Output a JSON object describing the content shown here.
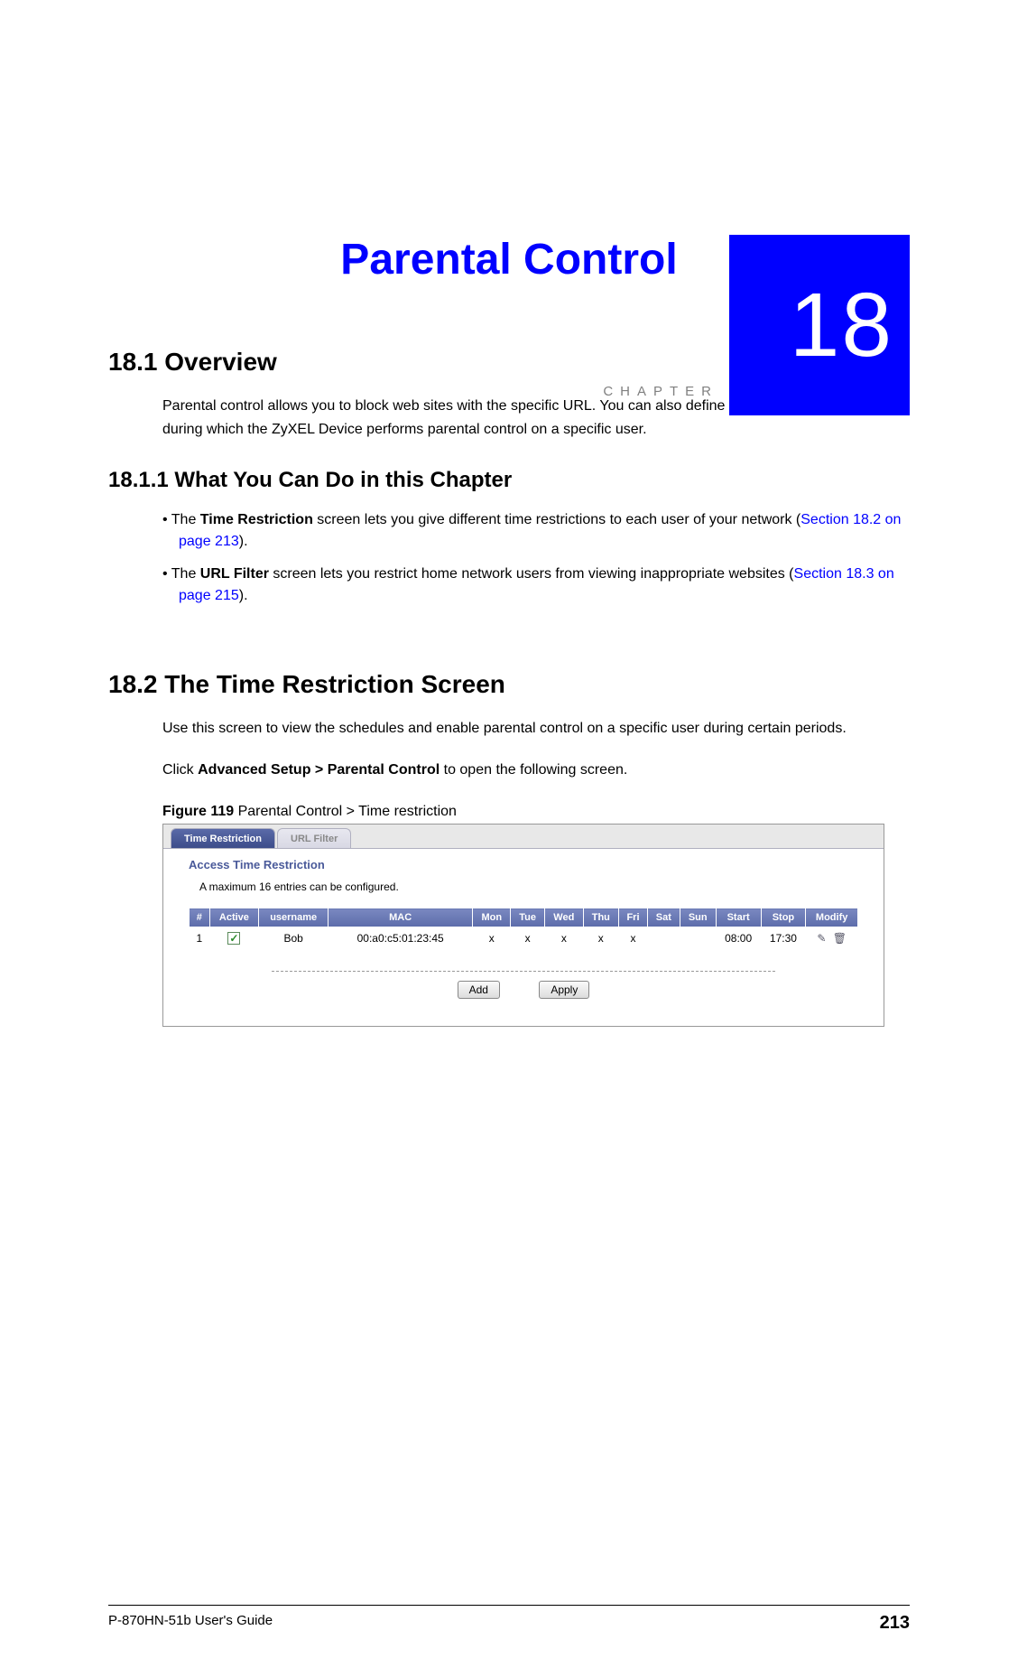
{
  "chapter": {
    "label": "CHAPTER",
    "number": "18",
    "title": "Parental Control"
  },
  "section_18_1": {
    "heading": "18.1  Overview",
    "body": "Parental control allows you to block web sites with the specific URL. You can also define time periods and days during which the ZyXEL Device performs parental control on a specific user."
  },
  "section_18_1_1": {
    "heading": "18.1.1  What You Can Do in this Chapter",
    "bullet1_a": "The ",
    "bullet1_bold": "Time Restriction",
    "bullet1_b": " screen lets you give different time restrictions to each user of your network (",
    "bullet1_link": "Section 18.2 on page 213",
    "bullet1_c": ").",
    "bullet2_a": "The ",
    "bullet2_bold": "URL Filter",
    "bullet2_b": " screen lets you restrict home network users from viewing inappropriate websites (",
    "bullet2_link": "Section 18.3 on page 215",
    "bullet2_c": ")."
  },
  "section_18_2": {
    "heading": "18.2  The Time Restriction Screen",
    "body1": "Use this screen to view the schedules and enable parental control on a specific user during certain periods.",
    "body2_a": "Click ",
    "body2_bold": "Advanced Setup > Parental Control",
    "body2_b": " to open the following screen."
  },
  "figure": {
    "label": "Figure 119",
    "caption": "   Parental Control > Time restriction"
  },
  "screenshot": {
    "tabs": {
      "active": "Time Restriction",
      "inactive": "URL Filter"
    },
    "panel_title": "Access Time Restriction",
    "note": "A maximum 16 entries can be configured.",
    "headers": {
      "num": "#",
      "active": "Active",
      "username": "username",
      "mac": "MAC",
      "mon": "Mon",
      "tue": "Tue",
      "wed": "Wed",
      "thu": "Thu",
      "fri": "Fri",
      "sat": "Sat",
      "sun": "Sun",
      "start": "Start",
      "stop": "Stop",
      "modify": "Modify"
    },
    "row": {
      "num": "1",
      "active_checked": true,
      "username": "Bob",
      "mac": "00:a0:c5:01:23:45",
      "mon": "x",
      "tue": "x",
      "wed": "x",
      "thu": "x",
      "fri": "x",
      "sat": "",
      "sun": "",
      "start": "08:00",
      "stop": "17:30"
    },
    "buttons": {
      "add": "Add",
      "apply": "Apply"
    }
  },
  "footer": {
    "guide": "P-870HN-51b User's Guide",
    "page": "213"
  }
}
